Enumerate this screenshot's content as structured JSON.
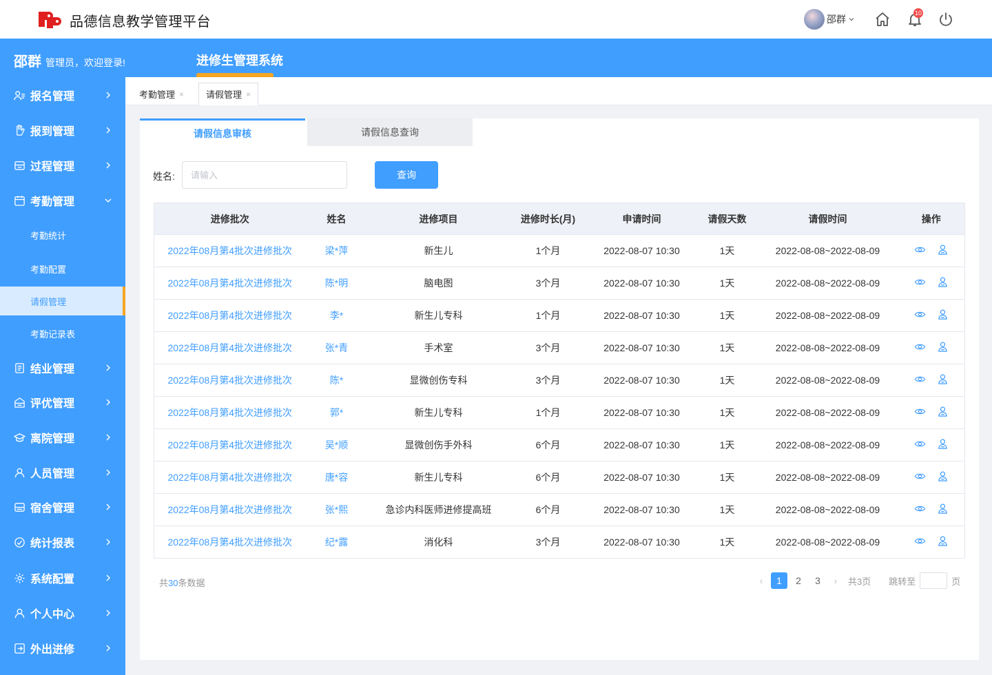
{
  "app": {
    "title": "品德信息教学管理平台"
  },
  "topbar": {
    "user_name": "邵群",
    "notification_count": "10"
  },
  "header": {
    "user_name": "邵群",
    "welcome_text": "管理员，欢迎登录!",
    "system_title": "进修生管理系统"
  },
  "sidebar": {
    "items": [
      {
        "label": "报名管理",
        "icon": "user-list-icon"
      },
      {
        "label": "报到管理",
        "icon": "hand-icon"
      },
      {
        "label": "过程管理",
        "icon": "process-icon"
      },
      {
        "label": "考勤管理",
        "icon": "calendar-icon",
        "expanded": true
      },
      {
        "label": "结业管理",
        "icon": "document-icon"
      },
      {
        "label": "评优管理",
        "icon": "award-icon"
      },
      {
        "label": "离院管理",
        "icon": "graduation-cap-icon"
      },
      {
        "label": "人员管理",
        "icon": "person-icon"
      },
      {
        "label": "宿舍管理",
        "icon": "bed-icon"
      },
      {
        "label": "统计报表",
        "icon": "chart-circle-icon"
      },
      {
        "label": "系统配置",
        "icon": "settings-icon"
      },
      {
        "label": "个人中心",
        "icon": "user-icon"
      },
      {
        "label": "外出进修",
        "icon": "exit-icon"
      }
    ],
    "subitems": [
      {
        "label": "考勤统计"
      },
      {
        "label": "考勤配置"
      },
      {
        "label": "请假管理",
        "active": true
      },
      {
        "label": "考勤记录表"
      }
    ]
  },
  "tabs": [
    {
      "label": "考勤管理",
      "close": "×"
    },
    {
      "label": "请假管理",
      "close": "×",
      "active": true
    }
  ],
  "subtabs": [
    {
      "label": "请假信息审核",
      "active": true
    },
    {
      "label": "请假信息查询"
    }
  ],
  "search": {
    "label": "姓名:",
    "placeholder": "请输入",
    "value": "",
    "button": "查询"
  },
  "table": {
    "headers": [
      "进修批次",
      "姓名",
      "进修项目",
      "进修时长(月)",
      "申请时间",
      "请假天数",
      "请假时间",
      "操作"
    ],
    "rows": [
      [
        "2022年08月第4批次进修批次",
        "梁*萍",
        "新生儿",
        "1个月",
        "2022-08-07  10:30",
        "1天",
        "2022-08-08~2022-08-09"
      ],
      [
        "2022年08月第4批次进修批次",
        "陈*明",
        "脑电图",
        "3个月",
        "2022-08-07  10:30",
        "1天",
        "2022-08-08~2022-08-09"
      ],
      [
        "2022年08月第4批次进修批次",
        "李*",
        "新生儿专科",
        "1个月",
        "2022-08-07  10:30",
        "1天",
        "2022-08-08~2022-08-09"
      ],
      [
        "2022年08月第4批次进修批次",
        "张*青",
        "手术室",
        "3个月",
        "2022-08-07  10:30",
        "1天",
        "2022-08-08~2022-08-09"
      ],
      [
        "2022年08月第4批次进修批次",
        "陈*",
        "显微创伤专科",
        "3个月",
        "2022-08-07  10:30",
        "1天",
        "2022-08-08~2022-08-09"
      ],
      [
        "2022年08月第4批次进修批次",
        "郭*",
        "新生儿专科",
        "1个月",
        "2022-08-07  10:30",
        "1天",
        "2022-08-08~2022-08-09"
      ],
      [
        "2022年08月第4批次进修批次",
        "吴*顺",
        "显微创伤手外科",
        "6个月",
        "2022-08-07  10:30",
        "1天",
        "2022-08-08~2022-08-09"
      ],
      [
        "2022年08月第4批次进修批次",
        "唐*容",
        "新生儿专科",
        "6个月",
        "2022-08-07  10:30",
        "1天",
        "2022-08-08~2022-08-09"
      ],
      [
        "2022年08月第4批次进修批次",
        "张*熙",
        "急诊内科医师进修提高班",
        "6个月",
        "2022-08-07  10:30",
        "1天",
        "2022-08-08~2022-08-09"
      ],
      [
        "2022年08月第4批次进修批次",
        "纪*露",
        "消化科",
        "3个月",
        "2022-08-07  10:30",
        "1天",
        "2022-08-08~2022-08-09"
      ]
    ],
    "row_actions": [
      "view-icon",
      "user-audit-icon"
    ]
  },
  "footer": {
    "total_prefix": "共",
    "total_count": "30",
    "total_suffix": "条数据",
    "pages": [
      "1",
      "2",
      "3"
    ],
    "current_page": "1",
    "page_total": "共3页",
    "jump_label": "跳转至",
    "jump_value": "",
    "jump_unit": "页"
  },
  "colors": {
    "primary": "#409eff",
    "accent": "#f5a623",
    "badge": "#f04c4c"
  }
}
